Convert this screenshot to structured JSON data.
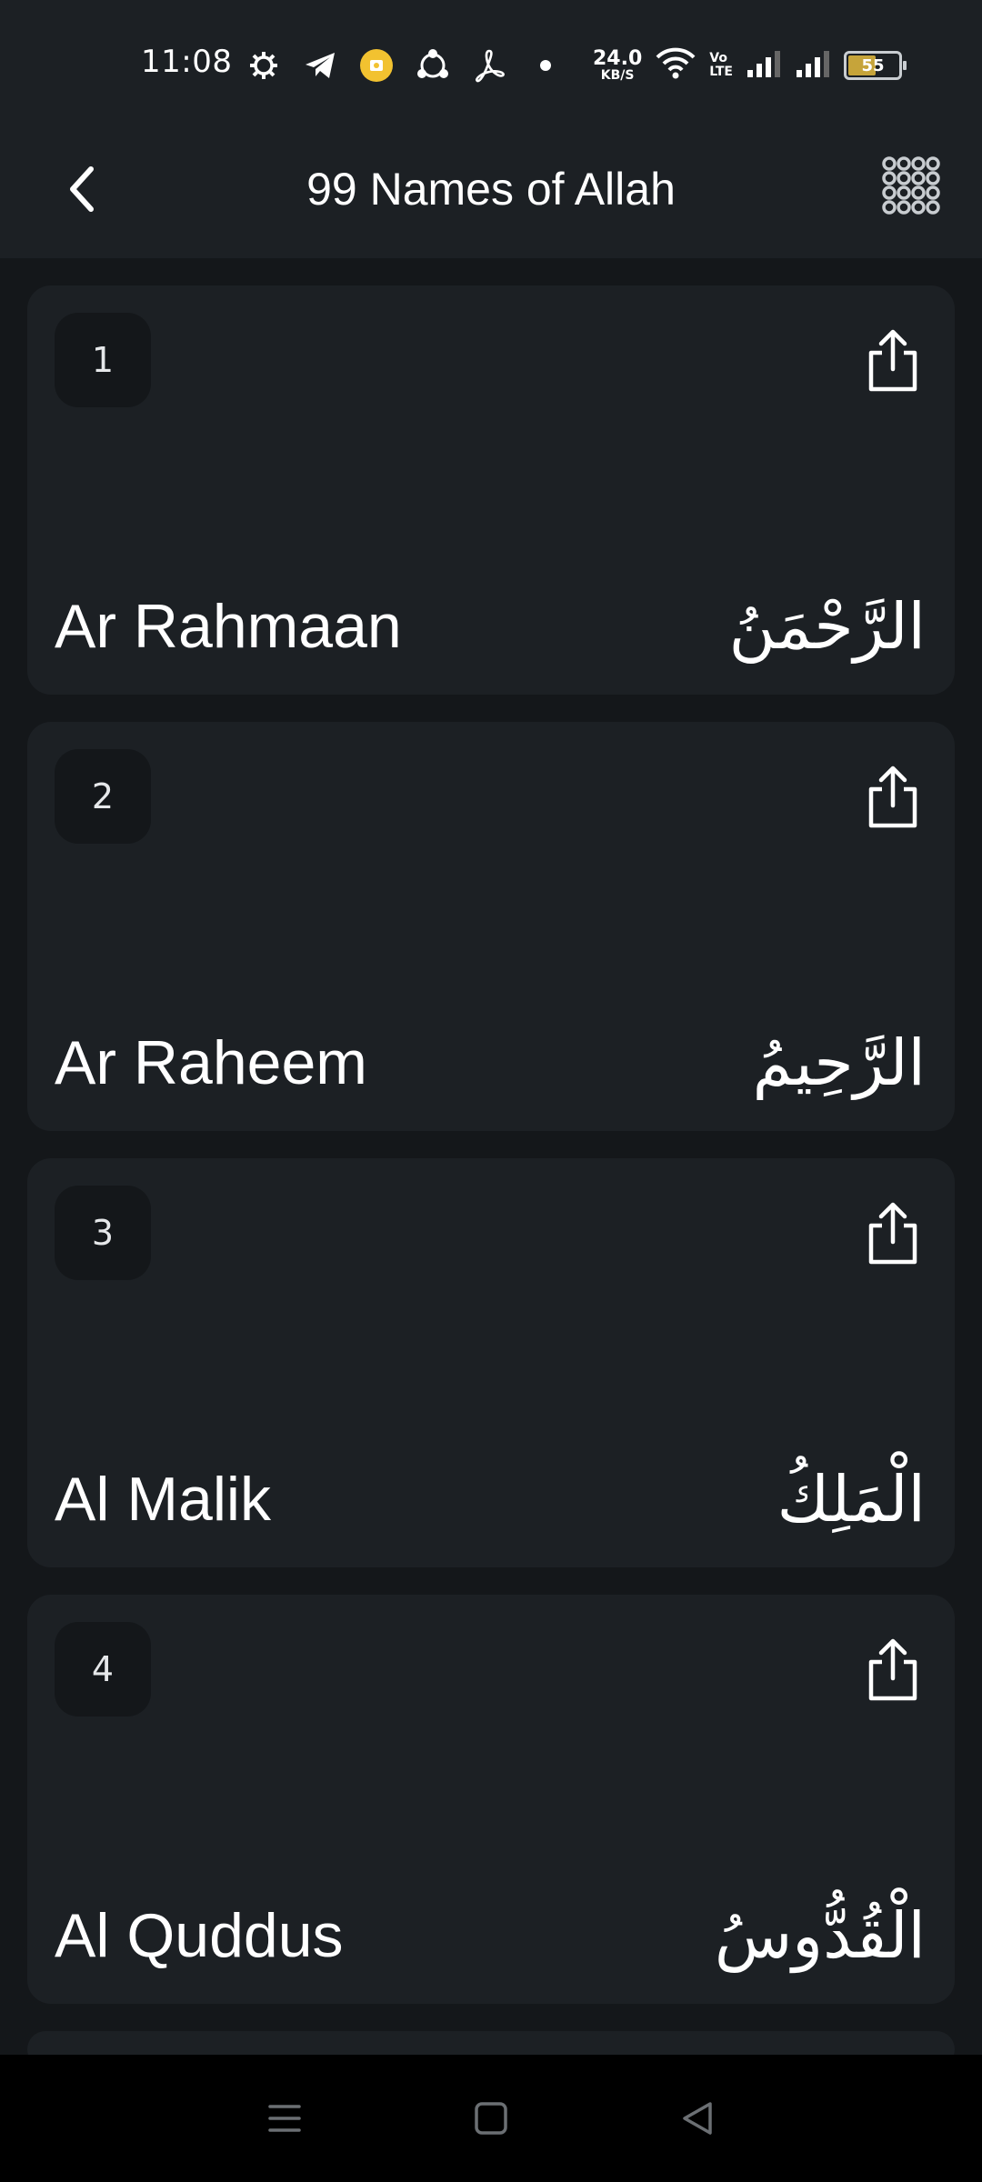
{
  "status_bar": {
    "time": "11:08",
    "net_speed_value": "24.0",
    "net_speed_unit": "KB/S",
    "volte_top": "Vo",
    "volte_bottom": "LTE",
    "battery_level": "55",
    "icons_left": [
      "gear-icon",
      "telegram-icon",
      "notification-badge-icon",
      "share-app-icon",
      "pdf-icon",
      "dot-icon"
    ],
    "icons_right": [
      "wifi-icon",
      "volte-icon",
      "signal-1-icon",
      "signal-2-icon",
      "battery-icon"
    ],
    "battery_color": "#c6a43a"
  },
  "header": {
    "title": "99 Names of Allah",
    "back_icon": "chevron-left-icon",
    "menu_icon": "grid-dots-icon"
  },
  "names": [
    {
      "number": "1",
      "english": "Ar Rahmaan",
      "arabic": "الرَّحْمَنُ"
    },
    {
      "number": "2",
      "english": "Ar Raheem",
      "arabic": "الرَّحِيمُ"
    },
    {
      "number": "3",
      "english": "Al Malik",
      "arabic": "الْمَلِكُ"
    },
    {
      "number": "4",
      "english": "Al Quddus",
      "arabic": "الْقُدُّوسُ"
    }
  ],
  "nav_bar": {
    "icons": [
      "menu-icon",
      "home-square-icon",
      "back-triangle-icon"
    ]
  },
  "colors": {
    "background": "#14171a",
    "card": "#1c2024",
    "text": "#ffffff"
  }
}
